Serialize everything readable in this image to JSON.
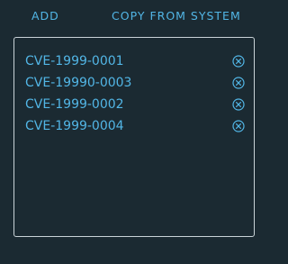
{
  "toolbar": {
    "add_label": "ADD",
    "copy_label": "COPY FROM SYSTEM"
  },
  "colors": {
    "background": "#1b2a32",
    "accent": "#52b6e6",
    "border": "#c9d3d8"
  },
  "items": [
    {
      "label": "CVE-1999-0001",
      "remove_icon": "circle-x-icon"
    },
    {
      "label": "CVE-19990-0003",
      "remove_icon": "circle-x-icon"
    },
    {
      "label": "CVE-1999-0002",
      "remove_icon": "circle-x-icon"
    },
    {
      "label": "CVE-1999-0004",
      "remove_icon": "circle-x-icon"
    }
  ]
}
